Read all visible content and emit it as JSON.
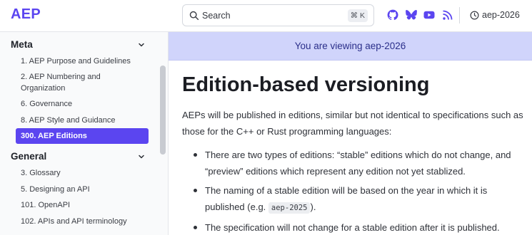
{
  "header": {
    "logo": "AEP",
    "search": {
      "label": "Search",
      "shortcut": "⌘ K"
    },
    "icons": [
      "github-icon",
      "bluesky-icon",
      "youtube-icon",
      "rss-icon"
    ],
    "version": {
      "label": "aep-2026",
      "icon": "clock-icon"
    }
  },
  "sidebar": {
    "groups": [
      {
        "title": "Meta",
        "items": [
          {
            "label": "1. AEP Purpose and Guidelines"
          },
          {
            "label": "2. AEP Numbering and Organization"
          },
          {
            "label": "6. Governance"
          },
          {
            "label": "8. AEP Style and Guidance"
          },
          {
            "label": "300. AEP Editions",
            "active": true
          }
        ]
      },
      {
        "title": "General",
        "items": [
          {
            "label": "3. Glossary"
          },
          {
            "label": "5. Designing an API"
          },
          {
            "label": "101. OpenAPI"
          },
          {
            "label": "102. APIs and API terminology"
          }
        ]
      }
    ]
  },
  "main": {
    "banner": "You are viewing aep-2026",
    "title": "Edition-based versioning",
    "intro": "AEPs will be published in editions, similar but not identical to specifications such as those for the C++ or Rust programming languages:",
    "bullets": [
      {
        "text": "There are two types of editions: “stable” editions which do not change, and “preview” editions which represent any edition not yet stablized."
      },
      {
        "before": "The naming of a stable edition will be based on the year in which it is published (e.g. ",
        "code": "aep-2025",
        "after": ")."
      },
      {
        "text": "The specification will not change for a stable edition after it is published."
      }
    ]
  },
  "colors": {
    "accent": "#5b45f0",
    "banner_bg": "#d0d4fb",
    "banner_text": "#2b2f8a"
  }
}
